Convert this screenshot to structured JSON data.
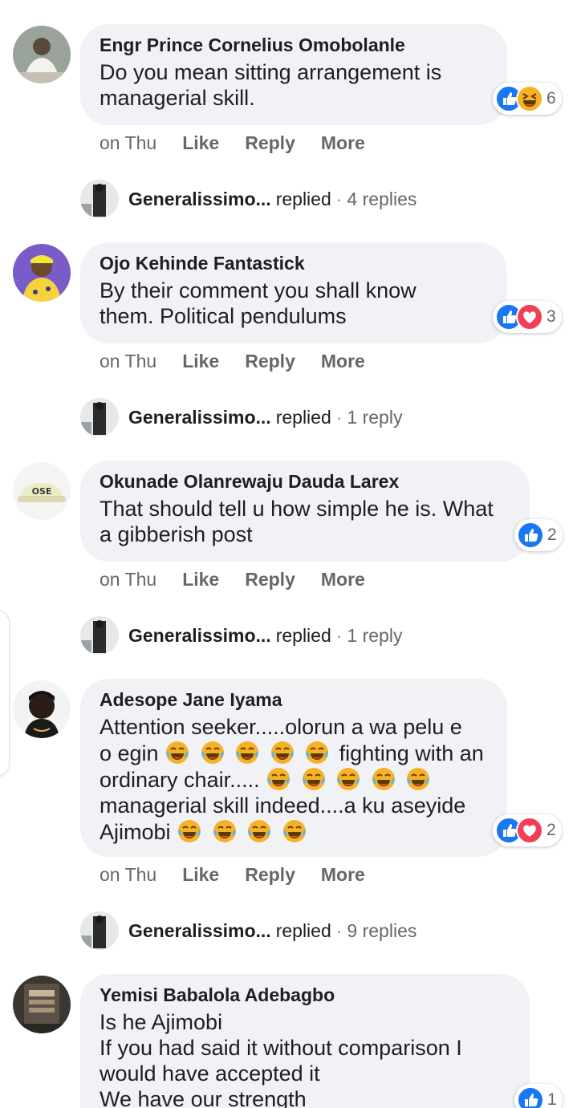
{
  "comments": [
    {
      "author": "Engr Prince Cornelius Omobolanle",
      "lines": [
        "Do you mean sitting arrangement is",
        "managerial skill."
      ],
      "reactions": {
        "icons": [
          "like-icon",
          "haha-icon"
        ],
        "count": "6"
      },
      "actions": {
        "time": "on Thu",
        "like": "Like",
        "reply": "Reply",
        "more": "More"
      },
      "replies": {
        "name": "Generalissimo...",
        "verb": "replied",
        "sep": "·",
        "count": "4 replies"
      }
    },
    {
      "author": "Ojo Kehinde Fantastick",
      "lines": [
        "By their comment you shall know",
        "them. Political pendulums"
      ],
      "reactions": {
        "icons": [
          "like-icon",
          "love-icon"
        ],
        "count": "3"
      },
      "actions": {
        "time": "on Thu",
        "like": "Like",
        "reply": "Reply",
        "more": "More"
      },
      "replies": {
        "name": "Generalissimo...",
        "verb": "replied",
        "sep": "·",
        "count": "1 reply"
      }
    },
    {
      "author": "Okunade Olanrewaju Dauda Larex",
      "lines": [
        "That should tell u how simple he is. What",
        "a gibberish post"
      ],
      "reactions": {
        "icons": [
          "like-icon"
        ],
        "count": "2"
      },
      "actions": {
        "time": "on Thu",
        "like": "Like",
        "reply": "Reply",
        "more": "More"
      },
      "replies": {
        "name": "Generalissimo...",
        "verb": "replied",
        "sep": "·",
        "count": "1 reply"
      }
    },
    {
      "author": "Adesope Jane Iyama",
      "lines": [
        {
          "text": "Attention seeker.....olorun a wa pelu e",
          "emoji": 0
        },
        {
          "text": "o egin",
          "emoji": 5,
          "after": " fighting with an"
        },
        {
          "text": "ordinary chair.....",
          "emoji": 5
        },
        {
          "text": "managerial skill indeed....a ku aseyide",
          "emoji": 0
        },
        {
          "text": "Ajimobi",
          "emoji": 4
        }
      ],
      "emoji_name": "tears-of-joy-emoji",
      "reactions": {
        "icons": [
          "like-icon",
          "love-icon"
        ],
        "count": "2"
      },
      "actions": {
        "time": "on Thu",
        "like": "Like",
        "reply": "Reply",
        "more": "More"
      },
      "replies": {
        "name": "Generalissimo...",
        "verb": "replied",
        "sep": "·",
        "count": "9 replies"
      }
    },
    {
      "author": "Yemisi Babalola Adebagbo",
      "lines": [
        "Is he Ajimobi",
        "If you had said it without comparison I",
        "would have accepted it",
        "We have our strength"
      ],
      "reactions": {
        "icons": [
          "like-icon"
        ],
        "count": "1"
      }
    }
  ],
  "colors": {
    "like_blue": "#1877f2",
    "love_red": "#f33e58",
    "haha_yellow": "#f7b125",
    "bubble_bg": "#f0f2f5",
    "meta_gray": "#65676b"
  }
}
